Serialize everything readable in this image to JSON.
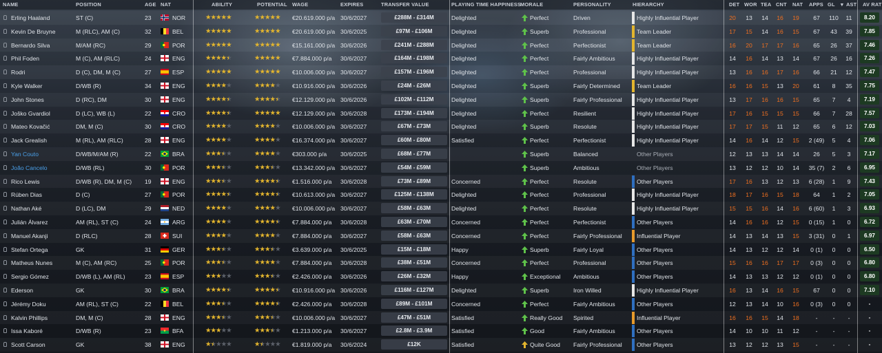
{
  "columns": {
    "name": "NAME",
    "position": "POSITION",
    "age": "AGE",
    "nat": "NAT",
    "ability": "ABILITY",
    "potential": "POTENTIAL",
    "wage": "WAGE",
    "expires": "EXPIRES",
    "transfer_value": "TRANSFER VALUE",
    "playing_time": "PLAYING TIME HAPPINESS",
    "morale": "MORALE",
    "personality": "PERSONALITY",
    "hierarchy": "HIERARCHY",
    "det": "DET",
    "wor": "WOR",
    "tea": "TEA",
    "cnt": "CNT",
    "nat2": "NAT",
    "apps": "APPS",
    "gls": "GL",
    "ast": "AST",
    "avrat": "AV RAT"
  },
  "colors": {
    "star_fill": "#e3b52e",
    "star_empty": "#5d626b",
    "orange_attr": "#f07020",
    "morale_green": "#5fc24a",
    "morale_yellow": "#e3b52e",
    "rating_bg": "#1d3a22",
    "hier_white": "#e6e6e6",
    "hier_yellow": "#e3b52e",
    "hier_blue": "#2f6fc0",
    "hier_orange": "#e79a2c",
    "link_blue": "#4a9fe8"
  },
  "players": [
    {
      "name": "Erling Haaland",
      "pos": "ST (C)",
      "age": "23",
      "nat": "NOR",
      "flag": "nor",
      "ab": 5,
      "pot": 5,
      "wage": "€20.619.000 p/a",
      "exp": "30/6/2027",
      "tv": "£288M - £314M",
      "pt": "Delighted",
      "morale": "Perfect",
      "pers": "Driven",
      "hier": "Highly Influential Player",
      "hc": "white",
      "det": "20",
      "wor": "13",
      "tea": "14",
      "cnt": "16",
      "nat2": "19",
      "apps": "67",
      "gls": "110",
      "ast": "11",
      "rat": "8.20"
    },
    {
      "name": "Kevin De Bruyne",
      "pos": "M (RLC), AM (C)",
      "age": "32",
      "nat": "BEL",
      "flag": "bel",
      "ab": 5,
      "pot": 5,
      "wage": "€20.619.000 p/a",
      "exp": "30/6/2025",
      "tv": "£97M - £106M",
      "pt": "Delighted",
      "morale": "Superb",
      "pers": "Professional",
      "hier": "Team Leader",
      "hc": "yellow",
      "det": "17",
      "wor": "15",
      "tea": "14",
      "cnt": "16",
      "nat2": "15",
      "apps": "67",
      "gls": "43",
      "ast": "39",
      "rat": "7.85"
    },
    {
      "name": "Bernardo Silva",
      "pos": "M/AM (RC)",
      "age": "29",
      "nat": "POR",
      "flag": "por",
      "ab": 5,
      "pot": 5,
      "wage": "€15.161.000 p/a",
      "exp": "30/6/2026",
      "tv": "£241M - £288M",
      "pt": "Delighted",
      "morale": "Perfect",
      "pers": "Perfectionist",
      "hier": "Team Leader",
      "hc": "yellow",
      "det": "16",
      "wor": "20",
      "tea": "17",
      "cnt": "17",
      "nat2": "16",
      "apps": "65",
      "gls": "26",
      "ast": "37",
      "rat": "7.46"
    },
    {
      "name": "Phil Foden",
      "pos": "M (C), AM (RLC)",
      "age": "24",
      "nat": "ENG",
      "flag": "eng",
      "ab": 4.5,
      "pot": 5,
      "wage": "€7.884.000 p/a",
      "exp": "30/6/2027",
      "tv": "£164M - £198M",
      "pt": "Delighted",
      "morale": "Perfect",
      "pers": "Fairly Ambitious",
      "hier": "Highly Influential Player",
      "hc": "white",
      "det": "14",
      "wor": "16",
      "tea": "14",
      "cnt": "13",
      "nat2": "14",
      "apps": "67",
      "gls": "26",
      "ast": "16",
      "rat": "7.26"
    },
    {
      "name": "Rodri",
      "pos": "D (C), DM, M (C)",
      "age": "27",
      "nat": "ESP",
      "flag": "esp",
      "ab": 5,
      "pot": 5,
      "wage": "€10.006.000 p/a",
      "exp": "30/6/2027",
      "tv": "£157M - £196M",
      "pt": "Delighted",
      "morale": "Perfect",
      "pers": "Professional",
      "hier": "Highly Influential Player",
      "hc": "white",
      "det": "13",
      "wor": "16",
      "tea": "16",
      "cnt": "17",
      "nat2": "16",
      "apps": "66",
      "gls": "21",
      "ast": "12",
      "rat": "7.47"
    },
    {
      "name": "Kyle Walker",
      "pos": "D/WB (R)",
      "age": "34",
      "nat": "ENG",
      "flag": "eng",
      "ab": 4,
      "pot": 4,
      "wage": "€10.916.000 p/a",
      "exp": "30/6/2026",
      "tv": "£24M - £26M",
      "pt": "Delighted",
      "morale": "Superb",
      "pers": "Fairly Determined",
      "hier": "Team Leader",
      "hc": "yellow",
      "det": "16",
      "wor": "16",
      "tea": "15",
      "cnt": "13",
      "nat2": "20",
      "apps": "61",
      "gls": "8",
      "ast": "35",
      "rat": "7.75"
    },
    {
      "name": "John Stones",
      "pos": "D (RC), DM",
      "age": "30",
      "nat": "ENG",
      "flag": "eng",
      "ab": 4.5,
      "pot": 4.5,
      "wage": "€12.129.000 p/a",
      "exp": "30/6/2026",
      "tv": "£102M - £112M",
      "pt": "Delighted",
      "morale": "Superb",
      "pers": "Fairly Professional",
      "hier": "Highly Influential Player",
      "hc": "white",
      "det": "13",
      "wor": "17",
      "tea": "16",
      "cnt": "16",
      "nat2": "15",
      "apps": "65",
      "gls": "7",
      "ast": "4",
      "rat": "7.19"
    },
    {
      "name": "Joško Gvardiol",
      "pos": "D (LC), WB (L)",
      "age": "22",
      "nat": "CRO",
      "flag": "cro",
      "ab": 4.5,
      "pot": 5,
      "wage": "€12.129.000 p/a",
      "exp": "30/6/2028",
      "tv": "£173M - £194M",
      "pt": "Delighted",
      "morale": "Perfect",
      "pers": "Resilient",
      "hier": "Highly Influential Player",
      "hc": "white",
      "det": "17",
      "wor": "16",
      "tea": "15",
      "cnt": "15",
      "nat2": "15",
      "apps": "66",
      "gls": "7",
      "ast": "28",
      "rat": "7.57"
    },
    {
      "name": "Mateo Kovačić",
      "pos": "DM, M (C)",
      "age": "30",
      "nat": "CRO",
      "flag": "cro",
      "ab": 4,
      "pot": 4,
      "wage": "€10.006.000 p/a",
      "exp": "30/6/2027",
      "tv": "£67M - £73M",
      "pt": "Delighted",
      "morale": "Superb",
      "pers": "Resolute",
      "hier": "Highly Influential Player",
      "hc": "white",
      "det": "17",
      "wor": "17",
      "tea": "15",
      "cnt": "11",
      "nat2": "12",
      "apps": "65",
      "gls": "6",
      "ast": "12",
      "rat": "7.03"
    },
    {
      "name": "Jack Grealish",
      "pos": "M (RL), AM (RLC)",
      "age": "28",
      "nat": "ENG",
      "flag": "eng",
      "ab": 4,
      "pot": 4,
      "wage": "€16.374.000 p/a",
      "exp": "30/6/2027",
      "tv": "£60M - £80M",
      "pt": "Satisfied",
      "morale": "Perfect",
      "pers": "Perfectionist",
      "hier": "Highly Influential Player",
      "hc": "white",
      "det": "14",
      "wor": "16",
      "tea": "14",
      "cnt": "12",
      "nat2": "15",
      "apps": "2 (49)",
      "gls": "5",
      "ast": "4",
      "rat": "7.06"
    },
    {
      "name": "Yan Couto",
      "pos": "D/WB/M/AM (R)",
      "age": "22",
      "nat": "BRA",
      "flag": "bra",
      "ab": 3.5,
      "pot": 4,
      "wage": "€303.000 p/a",
      "exp": "30/6/2025",
      "tv": "£68M - £77M",
      "pt": "",
      "morale": "Superb",
      "pers": "Balanced",
      "hier": "Other Players",
      "hc": "none",
      "det": "12",
      "wor": "13",
      "tea": "13",
      "cnt": "14",
      "nat2": "14",
      "apps": "26",
      "gls": "5",
      "ast": "3",
      "rat": "7.17",
      "link": true
    },
    {
      "name": "João Cancelo",
      "pos": "D/WB (RL)",
      "age": "30",
      "nat": "POR",
      "flag": "por",
      "ab": 3.5,
      "pot": 3.5,
      "wage": "€13.342.000 p/a",
      "exp": "30/6/2027",
      "tv": "£54M - £59M",
      "pt": "",
      "morale": "Superb",
      "pers": "Ambitious",
      "hier": "Other Players",
      "hc": "none",
      "det": "13",
      "wor": "12",
      "tea": "12",
      "cnt": "10",
      "nat2": "14",
      "apps": "35 (7)",
      "gls": "2",
      "ast": "6",
      "rat": "6.95",
      "link": true
    },
    {
      "name": "Rico Lewis",
      "pos": "D/WB (R), DM, M (C)",
      "age": "19",
      "nat": "ENG",
      "flag": "eng",
      "ab": 3.5,
      "pot": 4.5,
      "wage": "€1.516.000 p/a",
      "exp": "30/6/2028",
      "tv": "£73M - £89M",
      "pt": "Concerned",
      "morale": "Perfect",
      "pers": "Resolute",
      "hier": "Other Players",
      "hc": "blue",
      "det": "17",
      "wor": "16",
      "tea": "13",
      "cnt": "12",
      "nat2": "13",
      "apps": "6 (28)",
      "gls": "1",
      "ast": "9",
      "rat": "7.43"
    },
    {
      "name": "Rúben Dias",
      "pos": "D (C)",
      "age": "27",
      "nat": "POR",
      "flag": "por",
      "ab": 4.5,
      "pot": 4.5,
      "wage": "€10.613.000 p/a",
      "exp": "30/6/2027",
      "tv": "£125M - £138M",
      "pt": "Delighted",
      "morale": "Perfect",
      "pers": "Professional",
      "hier": "Highly Influential Player",
      "hc": "white",
      "det": "18",
      "wor": "17",
      "tea": "16",
      "cnt": "15",
      "nat2": "18",
      "apps": "64",
      "gls": "1",
      "ast": "2",
      "rat": "7.05"
    },
    {
      "name": "Nathan Aké",
      "pos": "D (LC), DM",
      "age": "29",
      "nat": "NED",
      "flag": "ned",
      "ab": 4,
      "pot": 4,
      "wage": "€10.006.000 p/a",
      "exp": "30/6/2027",
      "tv": "£58M - £63M",
      "pt": "Delighted",
      "morale": "Perfect",
      "pers": "Resolute",
      "hier": "Highly Influential Player",
      "hc": "white",
      "det": "15",
      "wor": "15",
      "tea": "16",
      "cnt": "14",
      "nat2": "16",
      "apps": "6 (60)",
      "gls": "1",
      "ast": "3",
      "rat": "6.93"
    },
    {
      "name": "Julián Álvarez",
      "pos": "AM (RL), ST (C)",
      "age": "24",
      "nat": "ARG",
      "flag": "arg",
      "ab": 4,
      "pot": 4.5,
      "wage": "€7.884.000 p/a",
      "exp": "30/6/2028",
      "tv": "£63M - £70M",
      "pt": "Concerned",
      "morale": "Perfect",
      "pers": "Perfectionist",
      "hier": "Other Players",
      "hc": "blue",
      "det": "14",
      "wor": "16",
      "tea": "16",
      "cnt": "12",
      "nat2": "15",
      "apps": "0 (15)",
      "gls": "1",
      "ast": "0",
      "rat": "6.72"
    },
    {
      "name": "Manuel Akanji",
      "pos": "D (RLC)",
      "age": "28",
      "nat": "SUI",
      "flag": "sui",
      "ab": 4,
      "pot": 4,
      "wage": "€7.884.000 p/a",
      "exp": "30/6/2027",
      "tv": "£58M - £63M",
      "pt": "Concerned",
      "morale": "Perfect",
      "pers": "Fairly Professional",
      "hier": "Influential Player",
      "hc": "orange",
      "det": "14",
      "wor": "13",
      "tea": "14",
      "cnt": "13",
      "nat2": "15",
      "apps": "3 (31)",
      "gls": "0",
      "ast": "1",
      "rat": "6.97"
    },
    {
      "name": "Stefan Ortega",
      "pos": "GK",
      "age": "31",
      "nat": "GER",
      "flag": "ger",
      "ab": 3.5,
      "pot": 3.5,
      "wage": "€3.639.000 p/a",
      "exp": "30/6/2025",
      "tv": "£15M - £18M",
      "pt": "Happy",
      "morale": "Superb",
      "pers": "Fairly Loyal",
      "hier": "Other Players",
      "hc": "blue",
      "det": "14",
      "wor": "13",
      "tea": "12",
      "cnt": "12",
      "nat2": "14",
      "apps": "0 (1)",
      "gls": "0",
      "ast": "0",
      "rat": "6.50"
    },
    {
      "name": "Matheus Nunes",
      "pos": "M (C), AM (RC)",
      "age": "25",
      "nat": "POR",
      "flag": "por",
      "ab": 3.5,
      "pot": 4,
      "wage": "€7.884.000 p/a",
      "exp": "30/6/2028",
      "tv": "£38M - £51M",
      "pt": "Concerned",
      "morale": "Perfect",
      "pers": "Professional",
      "hier": "Other Players",
      "hc": "blue",
      "det": "15",
      "wor": "16",
      "tea": "16",
      "cnt": "17",
      "nat2": "17",
      "apps": "0 (3)",
      "gls": "0",
      "ast": "0",
      "rat": "6.80"
    },
    {
      "name": "Sergio Gómez",
      "pos": "D/WB (L), AM (RL)",
      "age": "23",
      "nat": "ESP",
      "flag": "esp",
      "ab": 3,
      "pot": 3.5,
      "wage": "€2.426.000 p/a",
      "exp": "30/6/2026",
      "tv": "£26M - £32M",
      "pt": "Happy",
      "morale": "Exceptional",
      "pers": "Ambitious",
      "hier": "Other Players",
      "hc": "blue",
      "det": "14",
      "wor": "13",
      "tea": "13",
      "cnt": "12",
      "nat2": "12",
      "apps": "0 (1)",
      "gls": "0",
      "ast": "0",
      "rat": "6.80"
    },
    {
      "name": "Ederson",
      "pos": "GK",
      "age": "30",
      "nat": "BRA",
      "flag": "bra",
      "ab": 4.5,
      "pot": 4.5,
      "wage": "€10.916.000 p/a",
      "exp": "30/6/2026",
      "tv": "£116M - £127M",
      "pt": "Delighted",
      "morale": "Superb",
      "pers": "Iron Willed",
      "hier": "Highly Influential Player",
      "hc": "white",
      "det": "16",
      "wor": "13",
      "tea": "14",
      "cnt": "16",
      "nat2": "15",
      "apps": "67",
      "gls": "0",
      "ast": "0",
      "rat": "7.10"
    },
    {
      "name": "Jérémy Doku",
      "pos": "AM (RL), ST (C)",
      "age": "22",
      "nat": "BEL",
      "flag": "bel",
      "ab": 3.5,
      "pot": 4.5,
      "wage": "€2.426.000 p/a",
      "exp": "30/6/2028",
      "tv": "£89M - £101M",
      "pt": "Concerned",
      "morale": "Perfect",
      "pers": "Fairly Ambitious",
      "hier": "Other Players",
      "hc": "blue",
      "det": "12",
      "wor": "13",
      "tea": "14",
      "cnt": "10",
      "nat2": "16",
      "apps": "0 (3)",
      "gls": "0",
      "ast": "0",
      "rat": "-"
    },
    {
      "name": "Kalvin Phillips",
      "pos": "DM, M (C)",
      "age": "28",
      "nat": "ENG",
      "flag": "eng",
      "ab": 3.5,
      "pot": 3.5,
      "wage": "€10.006.000 p/a",
      "exp": "30/6/2027",
      "tv": "£47M - £51M",
      "pt": "Satisfied",
      "morale": "Really Good",
      "pers": "Spirited",
      "hier": "Influential Player",
      "hc": "orange",
      "det": "16",
      "wor": "16",
      "tea": "15",
      "cnt": "14",
      "nat2": "18",
      "apps": "-",
      "gls": "-",
      "ast": "-",
      "rat": "-"
    },
    {
      "name": "Issa Kaboré",
      "pos": "D/WB (R)",
      "age": "23",
      "nat": "BFA",
      "flag": "bfa",
      "ab": 3,
      "pot": 3.5,
      "wage": "€1.213.000 p/a",
      "exp": "30/6/2027",
      "tv": "£2.8M - £3.9M",
      "pt": "Satisfied",
      "morale": "Good",
      "pers": "Fairly Ambitious",
      "hier": "Other Players",
      "hc": "blue",
      "det": "14",
      "wor": "10",
      "tea": "10",
      "cnt": "11",
      "nat2": "12",
      "apps": "-",
      "gls": "-",
      "ast": "-",
      "rat": "-"
    },
    {
      "name": "Scott Carson",
      "pos": "GK",
      "age": "38",
      "nat": "ENG",
      "flag": "eng",
      "ab": 1.5,
      "pot": 1.5,
      "wage": "€1.819.000 p/a",
      "exp": "30/6/2024",
      "tv": "£12K",
      "pt": "Satisfied",
      "morale": "Quite Good",
      "pers": "Fairly Professional",
      "hier": "Other Players",
      "hc": "blue",
      "det": "13",
      "wor": "12",
      "tea": "12",
      "cnt": "13",
      "nat2": "15",
      "apps": "-",
      "gls": "-",
      "ast": "-",
      "rat": "-"
    }
  ]
}
